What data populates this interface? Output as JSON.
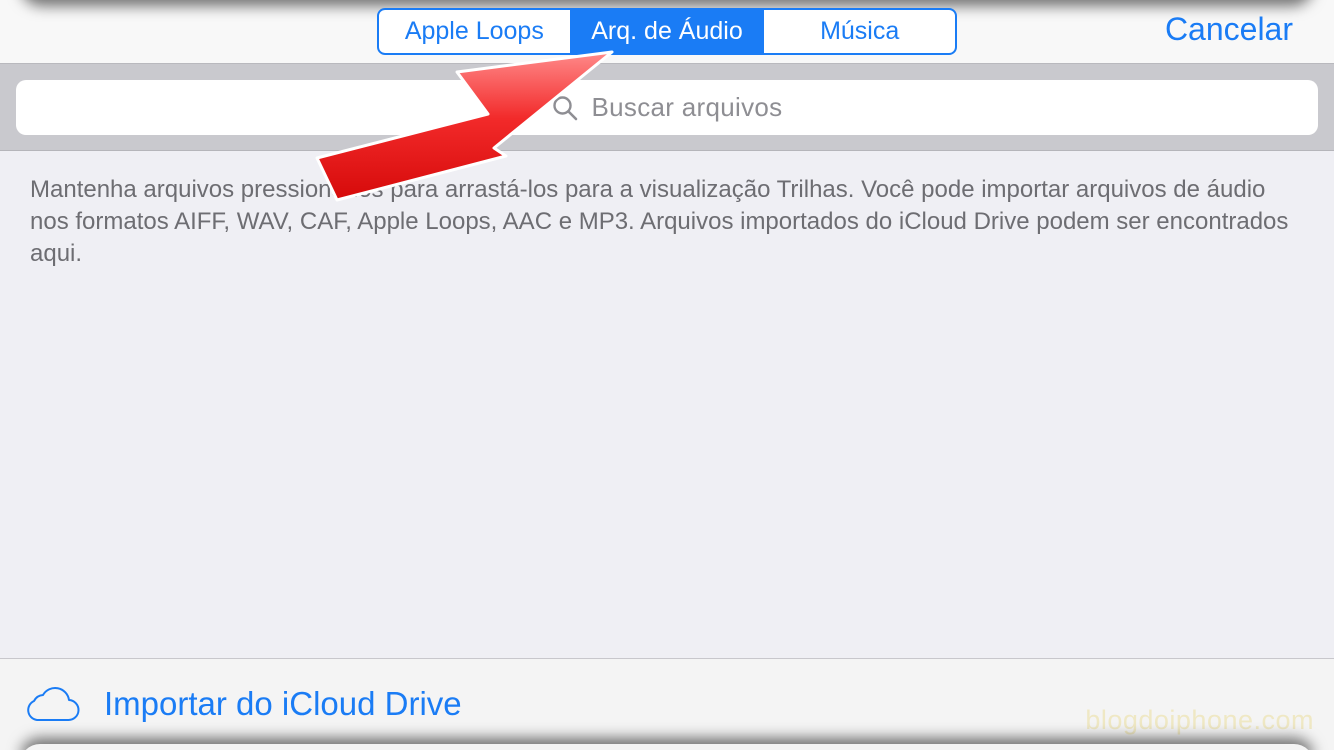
{
  "navbar": {
    "segments": [
      {
        "label": "Apple Loops",
        "selected": false
      },
      {
        "label": "Arq. de Áudio",
        "selected": true
      },
      {
        "label": "Música",
        "selected": false
      }
    ],
    "cancel_label": "Cancelar"
  },
  "search": {
    "placeholder": "Buscar arquivos",
    "icon": "search-icon"
  },
  "description": "Mantenha arquivos pressionados para arrastá-los para a visualização Trilhas. Você pode importar arquivos de áudio nos formatos AIFF, WAV, CAF, Apple Loops, AAC e MP3. Arquivos importados do iCloud Drive podem ser encontrados aqui.",
  "bottom_bar": {
    "import_label": "Importar do iCloud Drive",
    "icon": "cloud-icon"
  },
  "watermark": "blogdoiphone.com",
  "annotation": {
    "type": "red-arrow",
    "points_to": "Arq. de Áudio"
  },
  "colors": {
    "accent": "#1a7cf5",
    "background": "#efeff4",
    "search_band": "#c9c9ce",
    "arrow": "#ee1c1c"
  }
}
